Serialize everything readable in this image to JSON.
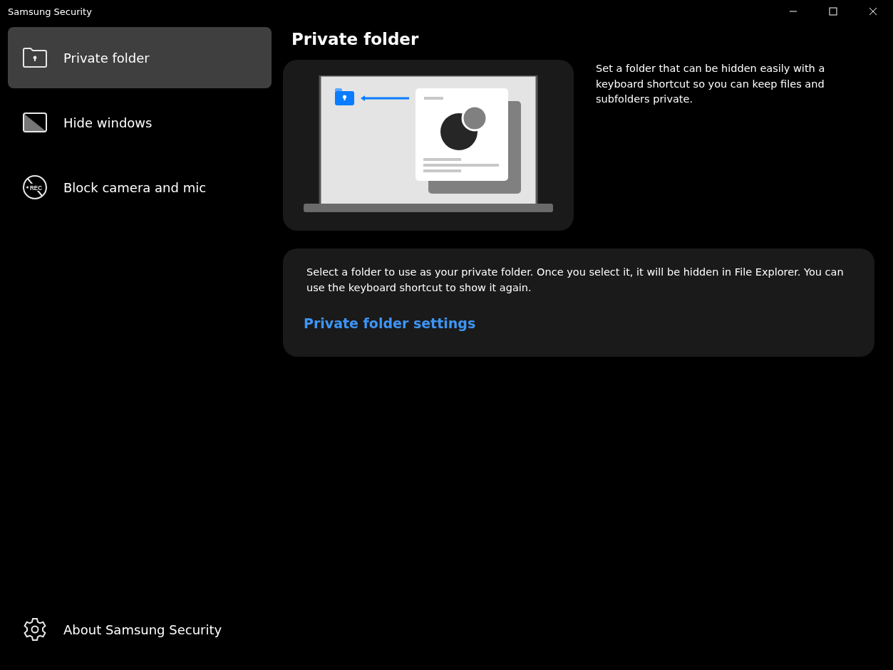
{
  "window": {
    "title": "Samsung Security"
  },
  "sidebar": {
    "items": [
      {
        "kind": "private-folder",
        "label": "Private folder",
        "selected": true
      },
      {
        "kind": "hide-windows",
        "label": "Hide windows",
        "selected": false
      },
      {
        "kind": "block-camera",
        "label": "Block camera and mic",
        "icon_text": "REC",
        "selected": false
      }
    ],
    "footer": {
      "label": "About Samsung Security"
    }
  },
  "content": {
    "title": "Private folder",
    "intro": "Set a folder that can be hidden easily with a keyboard shortcut so you can keep files and subfolders private.",
    "description": "Select a folder to use as your private folder. Once you select it, it will be hidden in File Explorer. You can use the keyboard shortcut to show it again.",
    "link": "Private folder settings"
  }
}
